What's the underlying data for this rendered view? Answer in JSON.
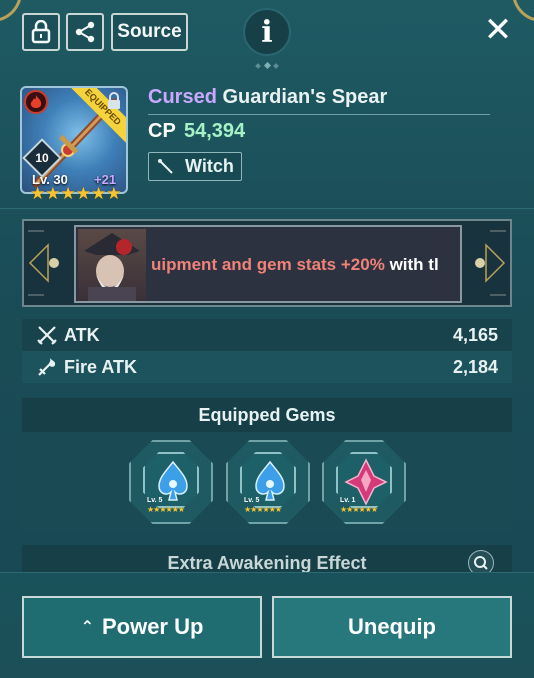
{
  "toolbar": {
    "lock_icon": "lock-icon",
    "share_icon": "share-icon",
    "source_label": "Source",
    "info_label": "i",
    "close_label": "✕"
  },
  "item": {
    "rarity": "Cursed",
    "name": "Guardian's Spear",
    "cp_label": "CP",
    "cp_value": "54,394",
    "class_label": "Witch",
    "equipped_ribbon": "EQUIPPED",
    "upgrade_level": "10",
    "level": "Lv. 30",
    "enhancement": "+21",
    "stars": 6,
    "element": "fire"
  },
  "set_bonus": {
    "text_prefix": "uipment and gem stats +20%",
    "text_suffix": "with tl"
  },
  "stats": [
    {
      "name": "ATK",
      "value": "4,165",
      "icon": "crossed-swords-icon"
    },
    {
      "name": "Fire ATK",
      "value": "2,184",
      "icon": "fire-sword-icon"
    }
  ],
  "gems": {
    "title": "Equipped Gems",
    "slots": [
      {
        "level": "Lv. 5",
        "color": "blue",
        "stars": "★★★★★★"
      },
      {
        "level": "Lv. 5",
        "color": "blue",
        "stars": "★★★★★★"
      },
      {
        "level": "Lv. 1",
        "color": "pink",
        "stars": "★★★★★★"
      }
    ]
  },
  "awakening": {
    "title": "Extra Awakening Effect"
  },
  "actions": {
    "power_up": "Power Up",
    "unequip": "Unequip"
  },
  "colors": {
    "rarity": "#c9a8ff",
    "cp_value": "#a6f2c6",
    "banner_text": "#f08278",
    "star": "#f7c431"
  }
}
